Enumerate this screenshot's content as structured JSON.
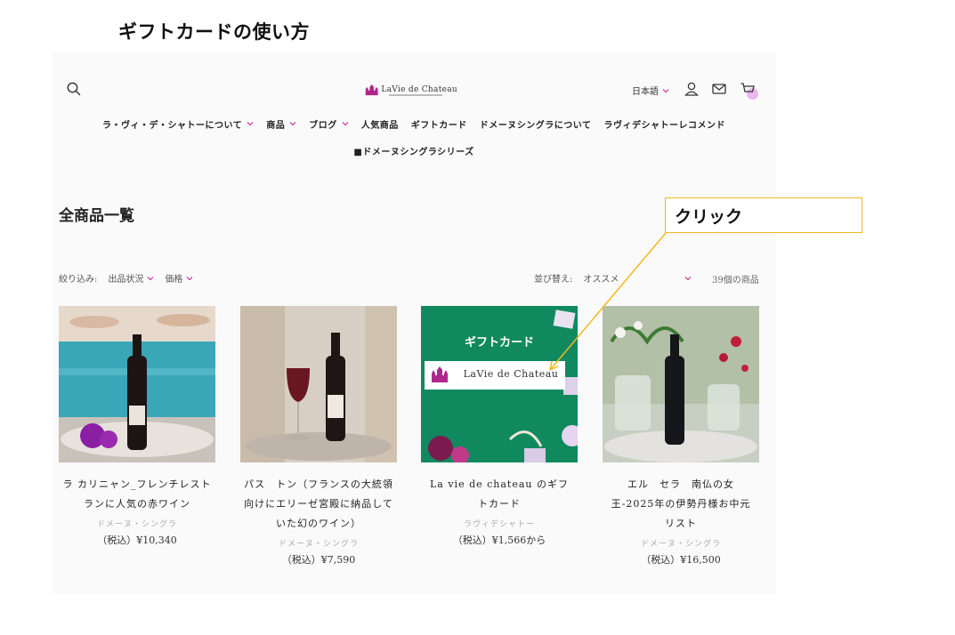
{
  "doc_title": "ギフトカードの使い方",
  "header": {
    "logo_text": "LaVie de Chateau",
    "language": "日本語"
  },
  "nav": {
    "row1": [
      {
        "label": "ラ・ヴィ・デ・シャトーについて",
        "chevron": true
      },
      {
        "label": "商品",
        "chevron": true
      },
      {
        "label": "ブログ",
        "chevron": true
      },
      {
        "label": "人気商品",
        "chevron": false
      },
      {
        "label": "ギフトカード",
        "chevron": false
      },
      {
        "label": "ドメーヌシングラについて",
        "chevron": false
      },
      {
        "label": "ラヴィデシャトーレコメンド",
        "chevron": false
      }
    ],
    "row2": [
      {
        "label": "■ドメーヌシングラシリーズ",
        "chevron": false
      }
    ]
  },
  "page_heading": "全商品一覧",
  "filters": {
    "label": "絞り込み:",
    "availability": "出品状況",
    "price": "価格"
  },
  "sort": {
    "label": "並び替え:",
    "value": "オススメ"
  },
  "product_count": "39個の商品",
  "products": [
    {
      "title": "ラ カリニャン_フレンチレストランに人気の赤ワイン",
      "maker": "ドメーヌ・シングラ",
      "price": "（税込）¥10,340"
    },
    {
      "title": "パス　トン（フランスの大統領向けにエリーゼ宮殿に納品していた幻のワイン）",
      "maker": "ドメーヌ・シングラ",
      "price": "（税込）¥7,590"
    },
    {
      "title": "La vie de chateau のギフトカード",
      "maker": "ラヴィデシャトー",
      "price": "（税込）¥1,566から"
    },
    {
      "title": "エル　セラ　南仏の女王-2025年の伊勢丹様お中元リスト",
      "maker": "ドメーヌ・シングラ",
      "price": "（税込）¥16,500"
    }
  ],
  "gift_card_image": {
    "heading": "ギフトカード",
    "logo_text": "LaVie de Chateau"
  },
  "callout": {
    "text": "クリック",
    "color": "#f3b820"
  },
  "colors": {
    "accent": "#c8329a",
    "gift_green": "#10895f",
    "callout_border": "#f3b820"
  }
}
